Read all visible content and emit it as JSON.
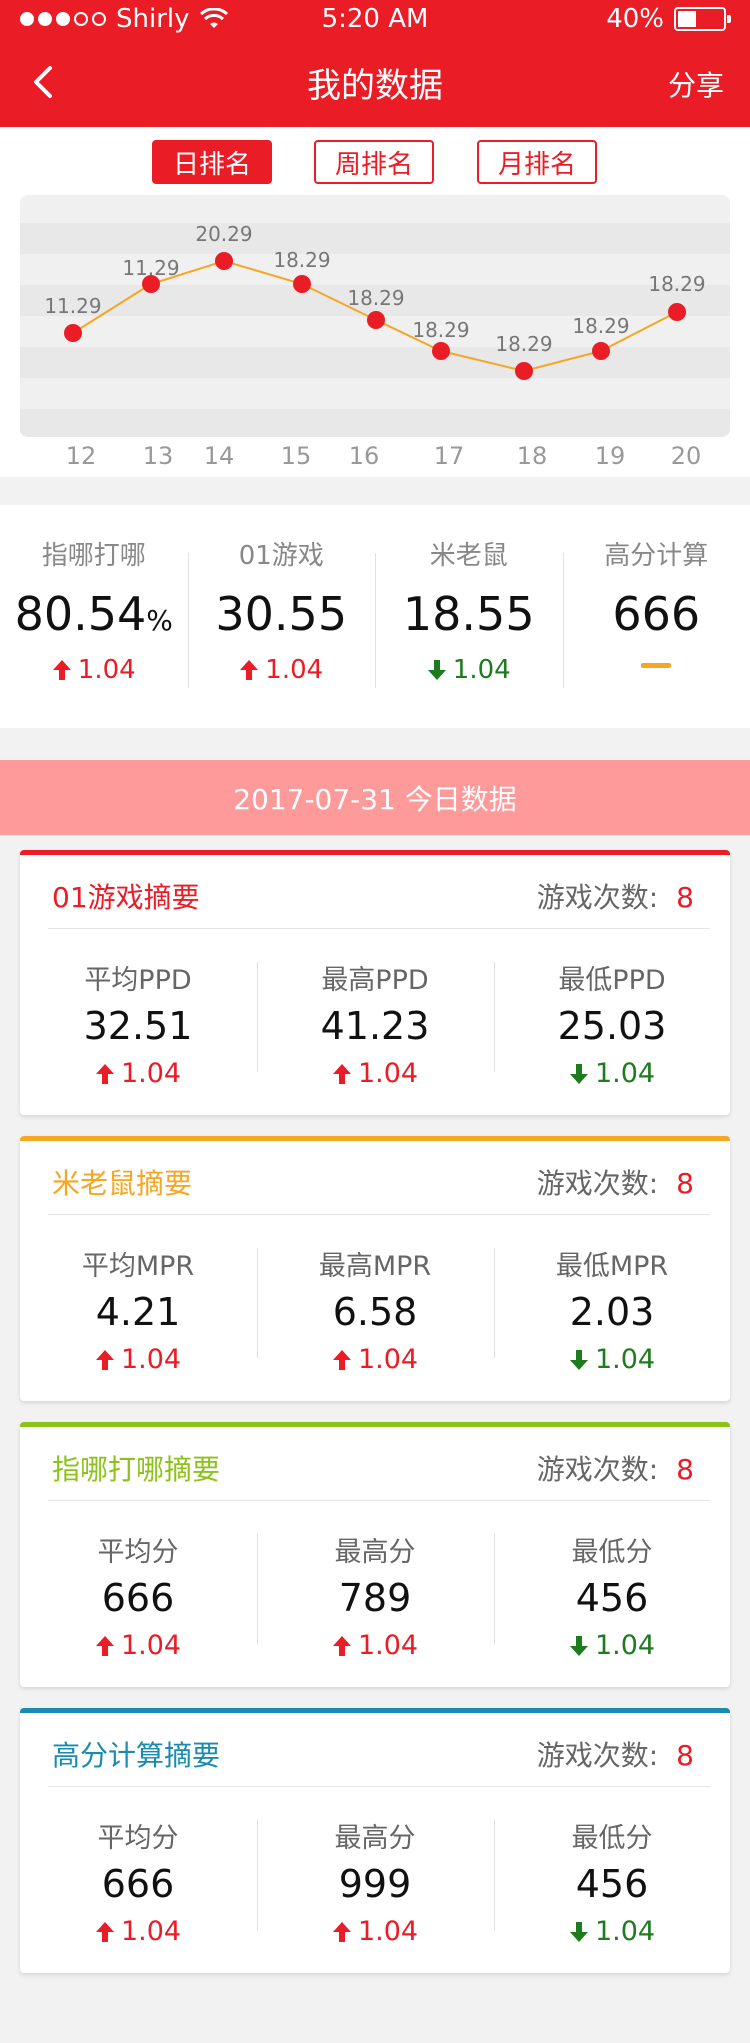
{
  "status": {
    "carrier": "Shirly",
    "time": "5:20 AM",
    "battery": "40%",
    "battery_level": 0.4
  },
  "nav": {
    "title": "我的数据",
    "share": "分享"
  },
  "tabs": [
    {
      "label": "日排名",
      "active": true
    },
    {
      "label": "周排名",
      "active": false
    },
    {
      "label": "月排名",
      "active": false
    }
  ],
  "chart_data": {
    "type": "line",
    "x": [
      "12",
      "13",
      "14",
      "15",
      "16",
      "17",
      "18",
      "19",
      "20"
    ],
    "values": [
      11.29,
      11.29,
      20.29,
      18.29,
      18.29,
      18.29,
      18.29,
      18.29,
      18.29
    ],
    "point_labels": [
      "11.29",
      "11.29",
      "20.29",
      "18.29",
      "18.29",
      "18.29",
      "18.29",
      "18.29",
      "18.29"
    ],
    "line_color": "#f5a623",
    "point_color": "#ea1c25",
    "grid": "alternating-bands"
  },
  "summary": [
    {
      "name": "指哪打哪",
      "value": "80.54",
      "unit": "%",
      "change": "1.04",
      "dir": "up"
    },
    {
      "name": "01游戏",
      "value": "30.55",
      "unit": "",
      "change": "1.04",
      "dir": "up"
    },
    {
      "name": "米老鼠",
      "value": "18.55",
      "unit": "",
      "change": "1.04",
      "dir": "down"
    },
    {
      "name": "高分计算",
      "value": "666",
      "unit": "",
      "change": "",
      "dir": "flat"
    }
  ],
  "date_banner": "2017-07-31 今日数据",
  "cards": [
    {
      "title": "01游戏摘要",
      "color": "#ea1c25",
      "count_label": "游戏次数:",
      "count": "8",
      "metrics": [
        {
          "name": "平均PPD",
          "value": "32.51",
          "change": "1.04",
          "dir": "up"
        },
        {
          "name": "最高PPD",
          "value": "41.23",
          "change": "1.04",
          "dir": "up"
        },
        {
          "name": "最低PPD",
          "value": "25.03",
          "change": "1.04",
          "dir": "down"
        }
      ]
    },
    {
      "title": "米老鼠摘要",
      "color": "#f5a623",
      "count_label": "游戏次数:",
      "count": "8",
      "metrics": [
        {
          "name": "平均MPR",
          "value": "4.21",
          "change": "1.04",
          "dir": "up"
        },
        {
          "name": "最高MPR",
          "value": "6.58",
          "change": "1.04",
          "dir": "up"
        },
        {
          "name": "最低MPR",
          "value": "2.03",
          "change": "1.04",
          "dir": "down"
        }
      ]
    },
    {
      "title": "指哪打哪摘要",
      "color": "#8cc21a",
      "count_label": "游戏次数:",
      "count": "8",
      "metrics": [
        {
          "name": "平均分",
          "value": "666",
          "change": "1.04",
          "dir": "up"
        },
        {
          "name": "最高分",
          "value": "789",
          "change": "1.04",
          "dir": "up"
        },
        {
          "name": "最低分",
          "value": "456",
          "change": "1.04",
          "dir": "down"
        }
      ]
    },
    {
      "title": "高分计算摘要",
      "color": "#1a8ab0",
      "count_label": "游戏次数:",
      "count": "8",
      "metrics": [
        {
          "name": "平均分",
          "value": "666",
          "change": "1.04",
          "dir": "up"
        },
        {
          "name": "最高分",
          "value": "999",
          "change": "1.04",
          "dir": "up"
        },
        {
          "name": "最低分",
          "value": "456",
          "change": "1.04",
          "dir": "down"
        }
      ]
    }
  ]
}
